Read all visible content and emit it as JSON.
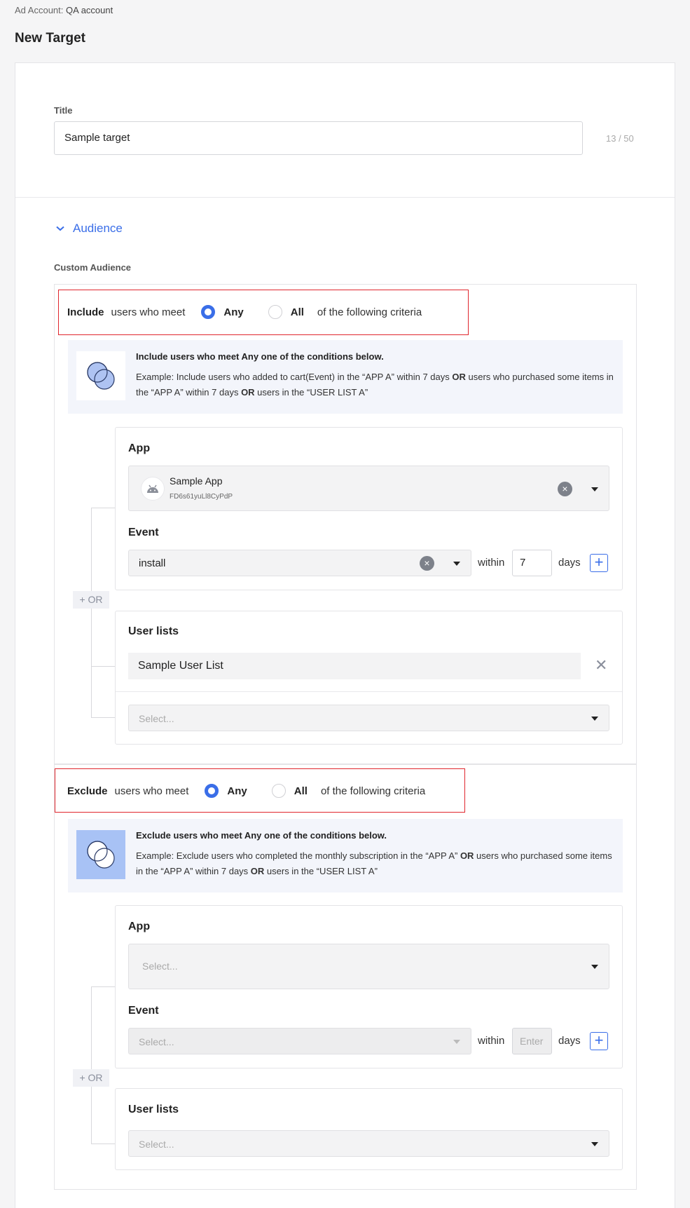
{
  "breadcrumb": {
    "key": "Ad Account:",
    "value": "QA account"
  },
  "page": {
    "title": "New Target"
  },
  "title_field": {
    "label": "Title",
    "value": "Sample target",
    "counter": "13 / 50"
  },
  "audience": {
    "toggle_label": "Audience",
    "section_label": "Custom Audience"
  },
  "include": {
    "mode": "Include",
    "text": "users who meet",
    "opt_any": "Any",
    "opt_all": "All",
    "suffix": "of the following criteria",
    "selected": "Any",
    "info_title": "Include users who meet Any one of the conditions below.",
    "info_pre": "Example: Include users who added to cart(Event) in the “APP A” within 7 days ",
    "info_or1": "OR",
    "info_mid": " users who purchased some items in the “APP A” within 7 days ",
    "info_or2": "OR",
    "info_post": " users in the “USER LIST A”",
    "app_label": "App",
    "app_name": "Sample App",
    "app_id": "FD6s61yuLl8CyPdP",
    "event_label": "Event",
    "event_value": "install",
    "within": "within",
    "days_value": "7",
    "days": "days",
    "or_label": "+ OR",
    "userlists_label": "User lists",
    "userlist_item": "Sample User List",
    "userlist_placeholder": "Select..."
  },
  "exclude": {
    "mode": "Exclude",
    "text": "users who meet",
    "opt_any": "Any",
    "opt_all": "All",
    "suffix": "of the following criteria",
    "selected": "Any",
    "info_title": "Exclude users who meet Any one of the conditions below.",
    "info_pre": "Example: Exclude users who completed the monthly subscription in the “APP A” ",
    "info_or1": "OR",
    "info_mid": " users who purchased some items in the “APP A” within 7 days ",
    "info_or2": "OR",
    "info_post": " users in the “USER LIST A”",
    "app_label": "App",
    "app_placeholder": "Select...",
    "event_label": "Event",
    "event_placeholder": "Select...",
    "within": "within",
    "days_placeholder": "Enter",
    "days": "days",
    "or_label": "+ OR",
    "userlists_label": "User lists",
    "userlist_placeholder": "Select..."
  },
  "colors": {
    "accent": "#3a6ee8",
    "highlight_border": "#e0262d",
    "info_bg": "#f3f5fb"
  }
}
